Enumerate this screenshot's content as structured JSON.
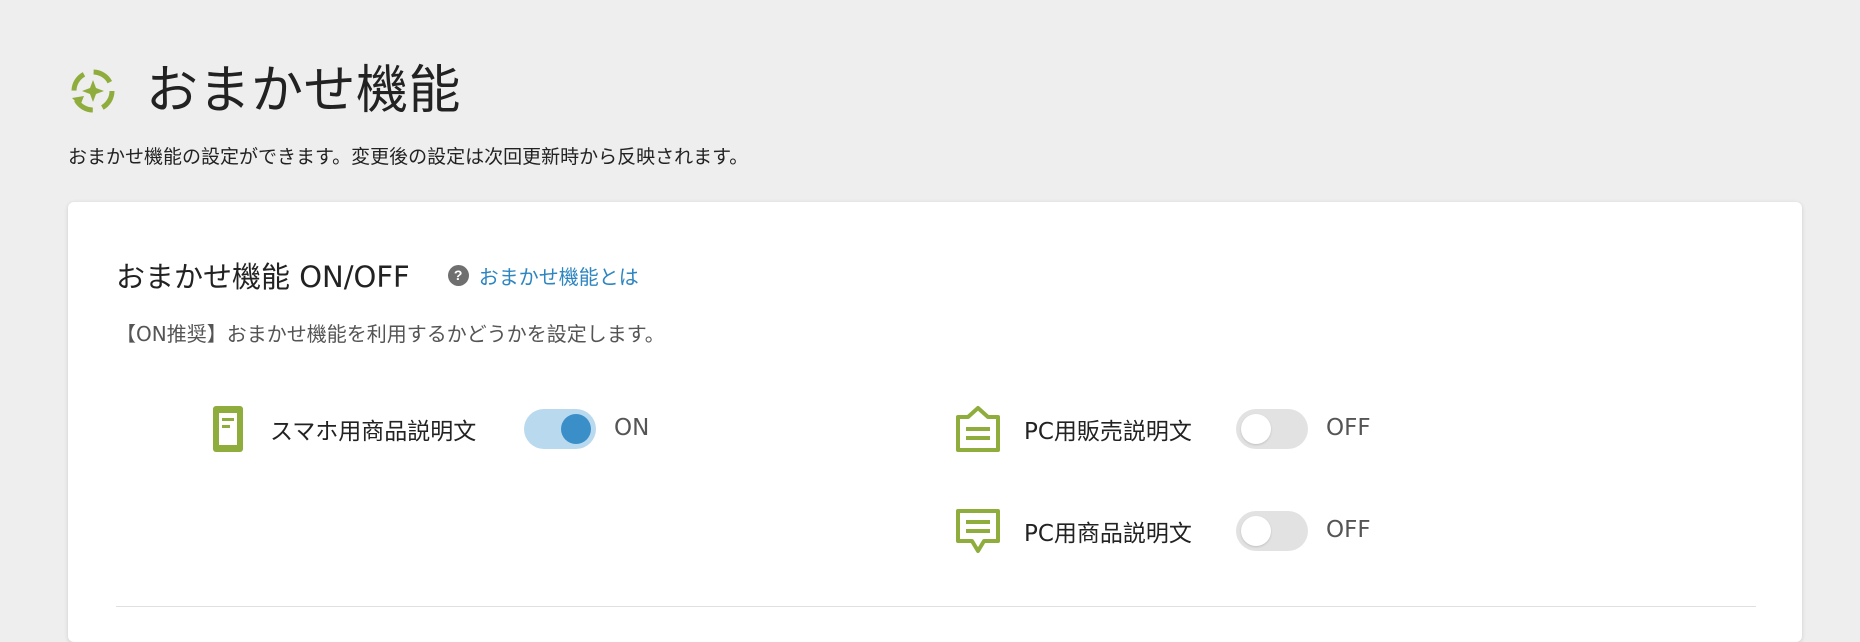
{
  "header": {
    "title": "おまかせ機能",
    "title_icon": "auto-sparkle-icon",
    "description": "おまかせ機能の設定ができます。変更後の設定は次回更新時から反映されます。"
  },
  "section": {
    "title": "おまかせ機能 ON/OFF",
    "help_link_label": "おまかせ機能とは",
    "help_icon_glyph": "?",
    "description": "【ON推奨】おまかせ機能を利用するかどうかを設定します。"
  },
  "settings": [
    {
      "icon": "smartphone-icon",
      "label": "スマホ用商品説明文",
      "enabled": true,
      "state_label": "ON"
    },
    {
      "icon": "pc-sales-description-icon",
      "label": "PC用販売説明文",
      "enabled": false,
      "state_label": "OFF"
    },
    {
      "icon": "pc-product-description-icon",
      "label": "PC用商品説明文",
      "enabled": false,
      "state_label": "OFF"
    }
  ],
  "colors": {
    "accent_green": "#8fad3d",
    "link_blue": "#2e86c1",
    "toggle_on_track": "#b9d9ee",
    "toggle_on_knob": "#3a8fc9",
    "toggle_off_track": "#e2e2e2"
  }
}
